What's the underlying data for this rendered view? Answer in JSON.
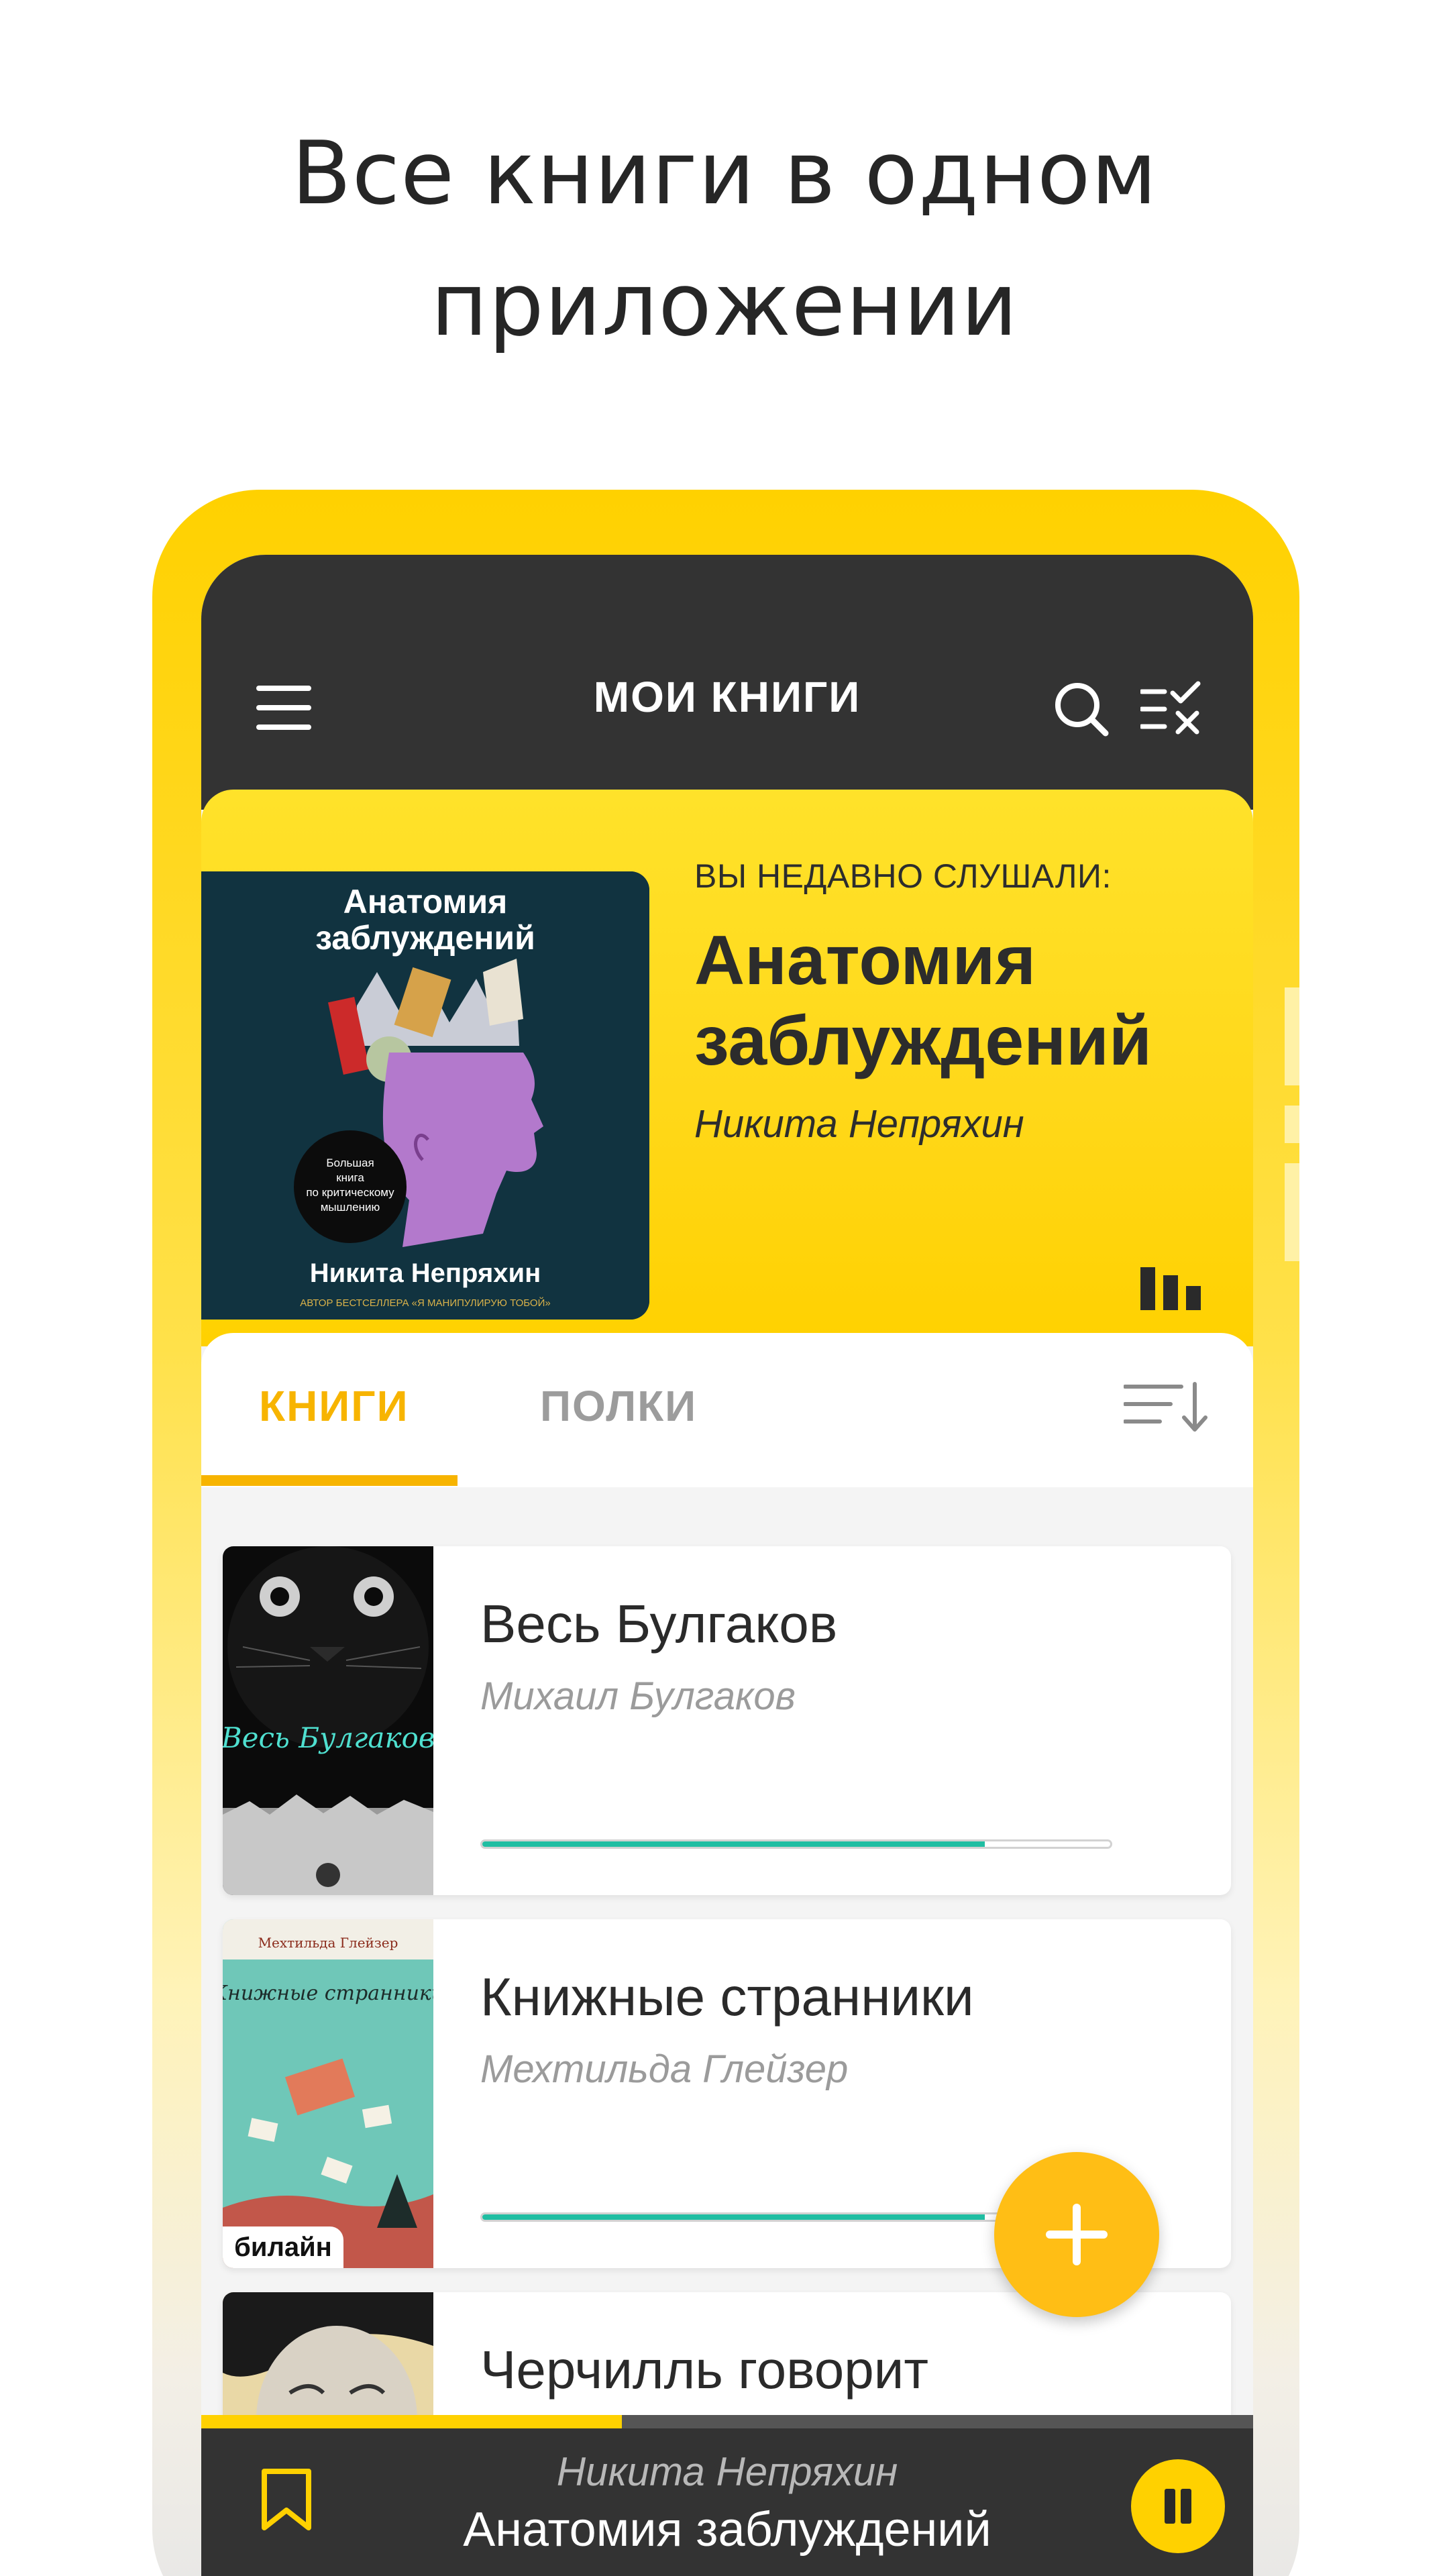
{
  "headline": {
    "line1": "Все книги в одном",
    "line2": "приложении"
  },
  "app_bar": {
    "title": "МОИ КНИГИ",
    "icons": [
      "menu-icon",
      "search-icon",
      "checklist-icon"
    ]
  },
  "recent": {
    "label": "ВЫ НЕДАВНО СЛУШАЛИ:",
    "title": "Анатомия заблуждений",
    "author": "Никита Непряхин",
    "cover": {
      "title_line1": "Анатомия",
      "title_line2": "заблуждений",
      "badge_line1": "Большая",
      "badge_line2": "книга",
      "badge_line3": "по критическому",
      "badge_line4": "мышлению",
      "author": "Никита Непряхин",
      "tagline": "АВТОР БЕСТСЕЛЛЕРА «Я МАНИПУЛИРУЮ ТОБОЙ»"
    }
  },
  "tabs": {
    "books": "КНИГИ",
    "shelves": "ПОЛКИ",
    "active": "books"
  },
  "books": [
    {
      "title": "Весь Булгаков",
      "author": "Михаил Булгаков",
      "progress": 0.8,
      "cover_text": "Весь Булгаков"
    },
    {
      "title": "Книжные странники",
      "author": "Мехтильда Глейзер",
      "progress": 0.8,
      "cover_top": "Мехтильда Глейзер",
      "cover_text": "Книжные странники",
      "cover_label": "билайн"
    },
    {
      "title": "Черчилль говорит",
      "author": "",
      "progress": null
    }
  ],
  "player": {
    "author": "Никита Непряхин",
    "title": "Анатомия заблуждений",
    "progress": 0.4
  },
  "colors": {
    "accent_yellow": "#ffd100",
    "fab_yellow": "#ffbe15",
    "tab_active": "#f7b400",
    "progress_teal": "#20bea2",
    "dark_bar": "#333333"
  }
}
